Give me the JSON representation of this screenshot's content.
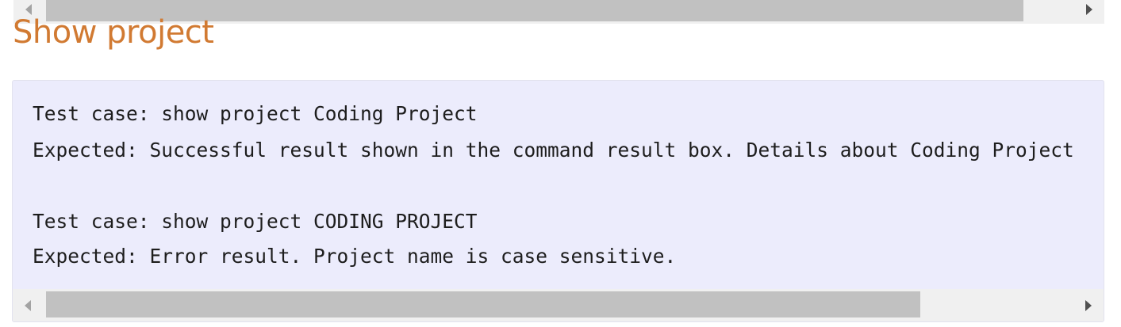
{
  "heading": "Show project",
  "code_lines": [
    "Test case: show project Coding Project",
    "Expected: Successful result shown in the command result box. Details about Coding Project",
    "Test case: show project CODING PROJECT",
    "Expected: Error result. Project name is case sensitive."
  ],
  "icons": {
    "scroll_left": "triangle-left",
    "scroll_right": "triangle-right"
  },
  "colors": {
    "heading": "#d17a32",
    "code_background": "#ececfc",
    "scrollbar_track": "#f0f0f0",
    "scrollbar_thumb": "#c1c1c1"
  }
}
